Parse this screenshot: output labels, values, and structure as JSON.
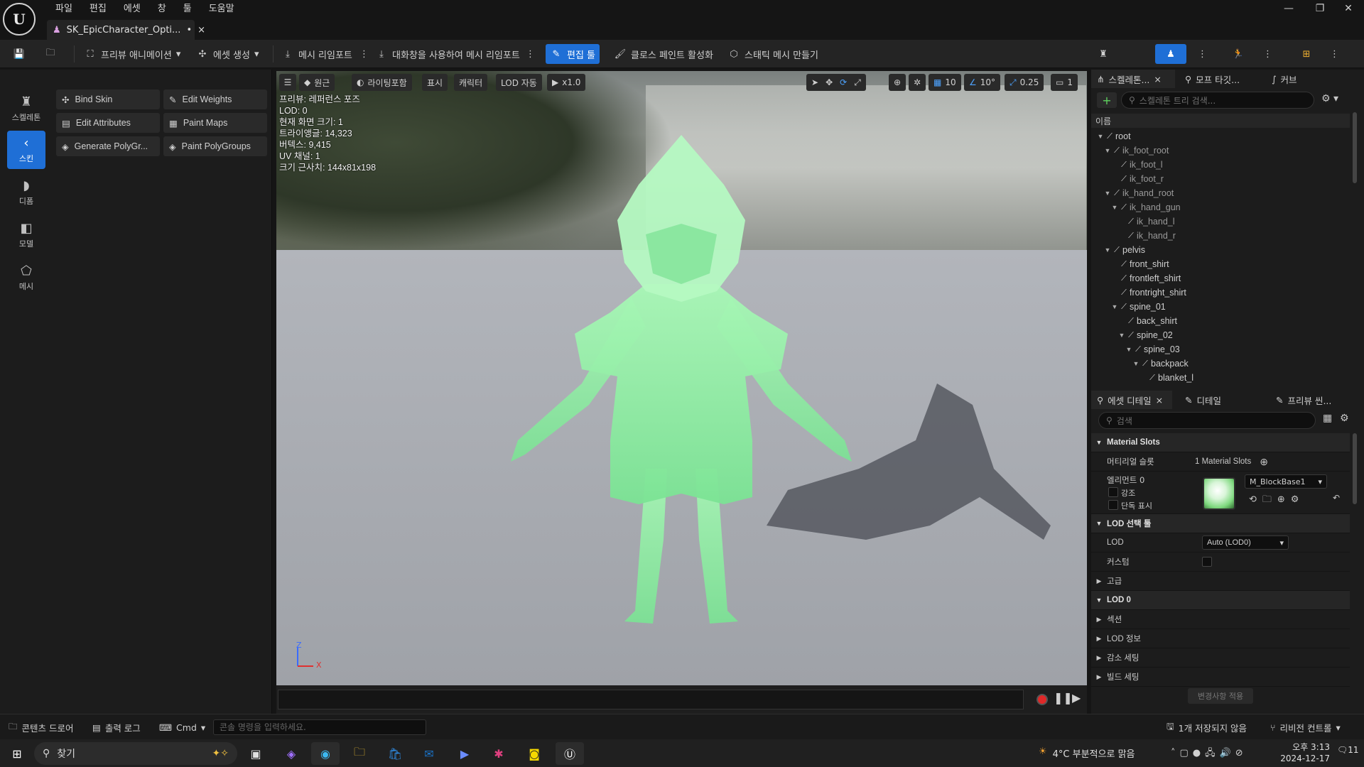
{
  "menu": [
    "파일",
    "편집",
    "에셋",
    "창",
    "툴",
    "도움말"
  ],
  "doc_tab": {
    "title": "SK_EpicCharacter_Opti...",
    "dirty": "•",
    "close": "×"
  },
  "window": {
    "min": "—",
    "restore": "❐",
    "close": "✕"
  },
  "toolbar": {
    "preview_anim": "프리뷰 애니메이션",
    "create_asset": "에셋 생성",
    "reimport": "메시 리임포트",
    "reimport_dialog": "대화창을 사용하여 메시 리임포트",
    "edit_tools": "편집 툴",
    "cloth_paint": "클로스 페인트 활성화",
    "static_mesh": "스태틱 메시 만들기"
  },
  "mode_bar": [
    {
      "label": "스켈레톤",
      "icon": "skeleton-icon"
    },
    {
      "label": "스킨",
      "icon": "skin-icon",
      "active": true
    },
    {
      "label": "디폼",
      "icon": "deform-icon"
    },
    {
      "label": "모델",
      "icon": "model-icon"
    },
    {
      "label": "메시",
      "icon": "mesh-icon"
    }
  ],
  "tools": [
    {
      "label": "Bind Skin",
      "icon": "bind-skin-icon"
    },
    {
      "label": "Edit Weights",
      "icon": "edit-weights-icon"
    },
    {
      "label": "Edit Attributes",
      "icon": "edit-attributes-icon"
    },
    {
      "label": "Paint Maps",
      "icon": "paint-maps-icon"
    },
    {
      "label": "Generate PolyGr...",
      "icon": "generate-polygroups-icon"
    },
    {
      "label": "Paint PolyGroups",
      "icon": "paint-polygroups-icon"
    }
  ],
  "viewport": {
    "menu_icon": "☰",
    "perspective": "원근",
    "lighting": "라이팅포함",
    "show": "표시",
    "character": "캐릭터",
    "lod": "LOD 자동",
    "speed": "x1.0",
    "grid_snap": "10",
    "rot_snap": "10°",
    "scale_snap": "0.25",
    "camera_speed": "1",
    "stats": [
      "프리뷰: 레퍼런스 포즈",
      "LOD: 0",
      "현재 화면 크기: 1",
      "트라이앵글: 14,323",
      "버텍스: 9,415",
      "UV 채널: 1",
      "크기 근사치: 144x81x198"
    ],
    "axis_z": "Z",
    "axis_x": "X"
  },
  "skeleton_panel": {
    "tabs": [
      "스켈레톤...",
      "모프 타깃...",
      "커브"
    ],
    "search_placeholder": "스켈레톤 트리 검색...",
    "header": "이름",
    "bones": [
      {
        "name": "root",
        "depth": 0,
        "expanded": true
      },
      {
        "name": "ik_foot_root",
        "depth": 1,
        "expanded": true,
        "dim": true
      },
      {
        "name": "ik_foot_l",
        "depth": 2,
        "dim": true
      },
      {
        "name": "ik_foot_r",
        "depth": 2,
        "dim": true
      },
      {
        "name": "ik_hand_root",
        "depth": 1,
        "expanded": true,
        "dim": true
      },
      {
        "name": "ik_hand_gun",
        "depth": 2,
        "expanded": true,
        "dim": true
      },
      {
        "name": "ik_hand_l",
        "depth": 3,
        "dim": true
      },
      {
        "name": "ik_hand_r",
        "depth": 3,
        "dim": true
      },
      {
        "name": "pelvis",
        "depth": 1,
        "expanded": true
      },
      {
        "name": "front_shirt",
        "depth": 2
      },
      {
        "name": "frontleft_shirt",
        "depth": 2
      },
      {
        "name": "frontright_shirt",
        "depth": 2
      },
      {
        "name": "spine_01",
        "depth": 2,
        "expanded": true
      },
      {
        "name": "back_shirt",
        "depth": 3
      },
      {
        "name": "spine_02",
        "depth": 3,
        "expanded": true
      },
      {
        "name": "spine_03",
        "depth": 4,
        "expanded": true
      },
      {
        "name": "backpack",
        "depth": 5,
        "expanded": true
      },
      {
        "name": "blanket_l",
        "depth": 6
      }
    ]
  },
  "details_panel": {
    "tabs": [
      "에셋 디테일",
      "디테일",
      "프리뷰 씬..."
    ],
    "search_placeholder": "검색",
    "material_slots_cat": "Material Slots",
    "material_slots_label": "머티리얼 슬롯",
    "material_slots_value": "1 Material Slots",
    "element0": "엘리먼트 0",
    "highlight": "강조",
    "isolate": "단독 표시",
    "material_name": "M_BlockBase1",
    "lod_picker_cat": "LOD 선택 툴",
    "lod_label": "LOD",
    "lod_value": "Auto (LOD0)",
    "custom_label": "커스텀",
    "advanced": "고급",
    "lod0_cat": "LOD 0",
    "sections": "섹션",
    "lod_info": "LOD 정보",
    "reduction": "감소 세팅",
    "build": "빌드 세팅",
    "apply_changes": "변경사항 적용"
  },
  "statusbar": {
    "content_drawer": "콘텐츠 드로어",
    "output_log": "출력 로그",
    "cmd": "Cmd",
    "console_placeholder": "콘솔 명령을 입력하세요.",
    "unsaved": "1개 저장되지 않음",
    "revision_control": "리비전 컨트롤"
  },
  "taskbar": {
    "search": "찾기",
    "weather": "4°C  부분적으로 맑음",
    "time": "오후 3:13",
    "date": "2024-12-17",
    "notif": "11"
  },
  "colors": {
    "accent": "#1f6fd6",
    "mesh": "#8ff2a4",
    "panel": "#1c1c1c"
  }
}
